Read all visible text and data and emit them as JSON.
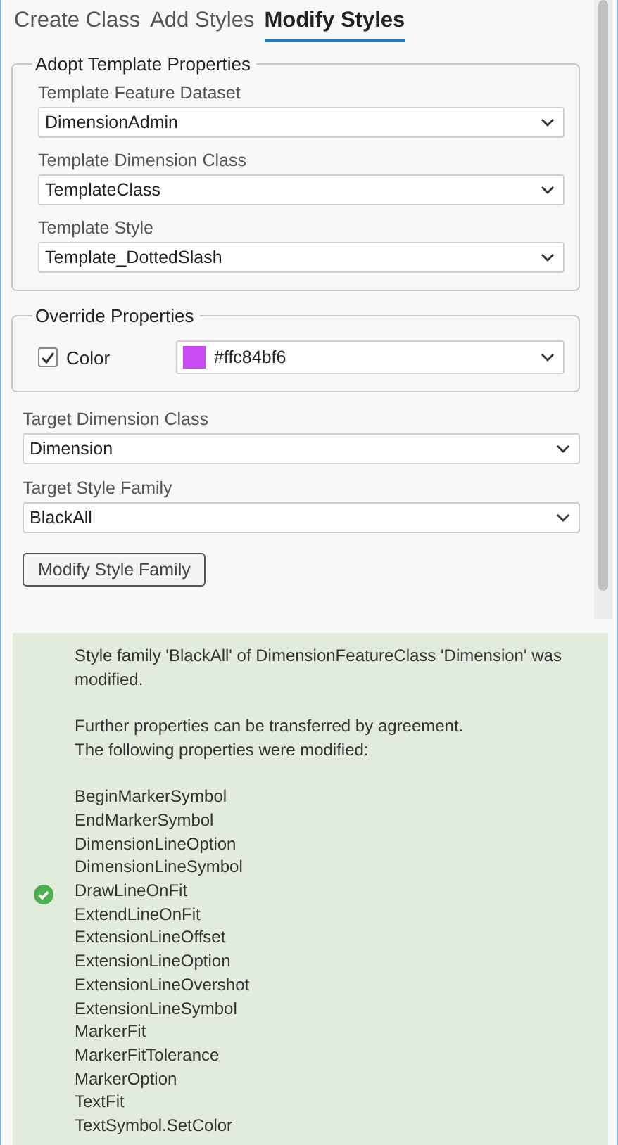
{
  "tabs": [
    {
      "label": "Create Class",
      "selected": false
    },
    {
      "label": "Add Styles",
      "selected": false
    },
    {
      "label": "Modify Styles",
      "selected": true
    }
  ],
  "adopt_group": {
    "title": "Adopt Template Properties",
    "fields": [
      {
        "label": "Template Feature Dataset",
        "value": "DimensionAdmin"
      },
      {
        "label": "Template Dimension Class",
        "value": "TemplateClass"
      },
      {
        "label": "Template Style",
        "value": "Template_DottedSlash"
      }
    ]
  },
  "override_group": {
    "title": "Override Properties",
    "checkbox": {
      "label": "Color",
      "checked": true
    },
    "color_field": {
      "value": "#ffc84bf6",
      "color": "#c84bf6"
    }
  },
  "target_fields": [
    {
      "label": "Target Dimension Class",
      "value": "Dimension"
    },
    {
      "label": "Target Style Family",
      "value": "BlackAll"
    }
  ],
  "modify_button": "Modify Style Family",
  "message": {
    "kind": "success",
    "paragraphs": [
      "Style family 'BlackAll' of DimensionFeatureClass 'Dimension' was modified."
    ],
    "lines": [
      "Further properties can be transferred by agreement.",
      "The following properties were modified:"
    ],
    "properties": [
      "BeginMarkerSymbol",
      "EndMarkerSymbol",
      "DimensionLineOption",
      "DimensionLineSymbol",
      "DrawLineOnFit",
      "ExtendLineOnFit",
      "ExtensionLineOffset",
      "ExtensionLineOption",
      "ExtensionLineOvershot",
      "ExtensionLineSymbol",
      "MarkerFit",
      "MarkerFitTolerance",
      "MarkerOption",
      "TextFit",
      "TextSymbol.SetColor"
    ]
  }
}
